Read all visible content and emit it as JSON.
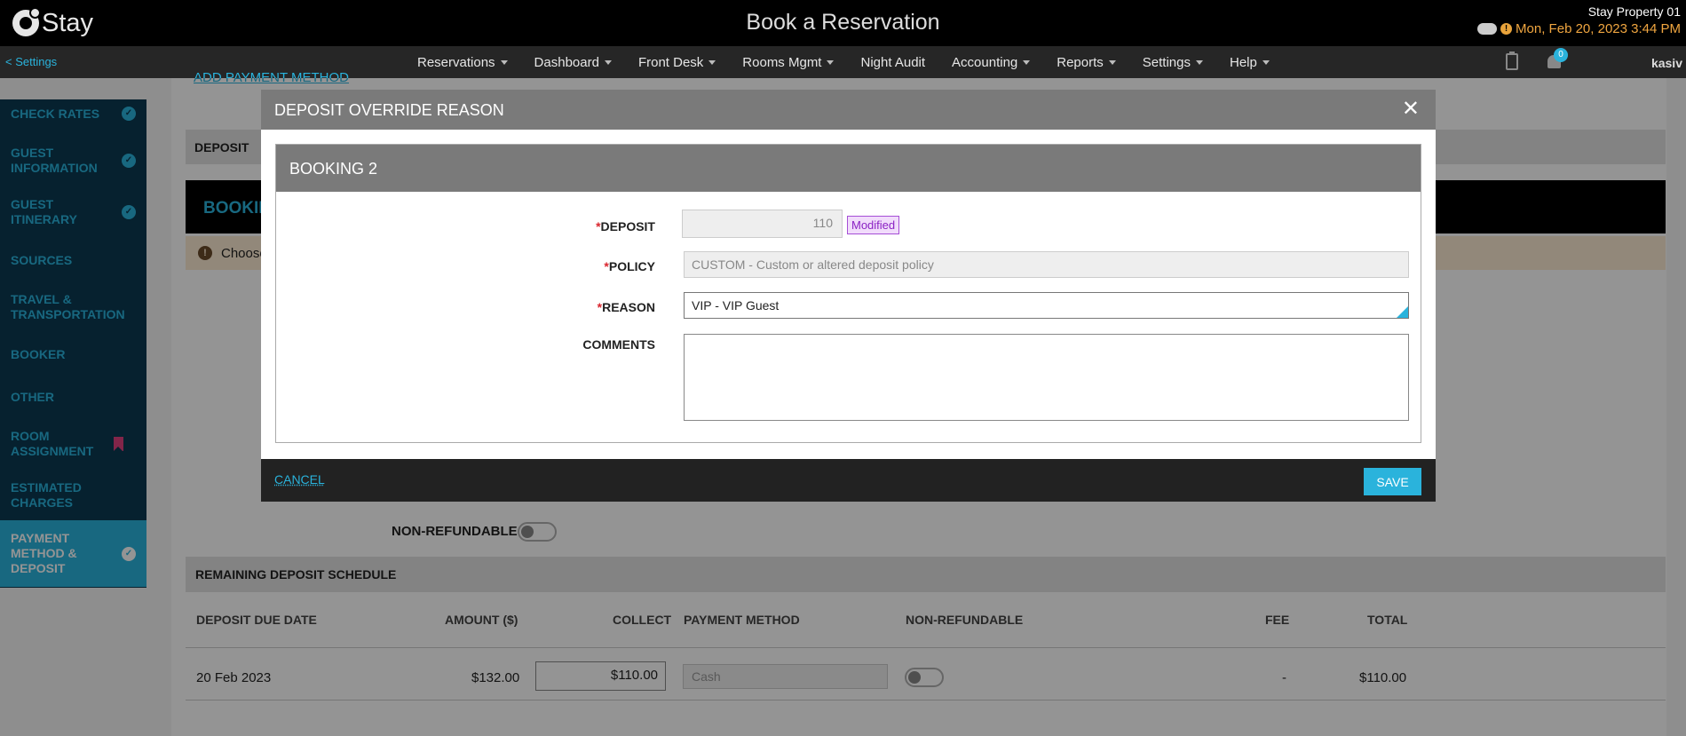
{
  "app": {
    "logo_text": "Stay",
    "title": "Book a Reservation",
    "property": "Stay Property 01",
    "datetime": "Mon, Feb 20, 2023 3:44 PM",
    "user": "kasiv"
  },
  "nav": {
    "back_label": "< Settings",
    "menus": [
      "Reservations",
      "Dashboard",
      "Front Desk",
      "Rooms Mgmt",
      "Night Audit",
      "Accounting",
      "Reports",
      "Settings",
      "Help"
    ],
    "notification_count": "0"
  },
  "sidebar": {
    "items": [
      {
        "label": "CHECK RATES"
      },
      {
        "label": "GUEST INFORMATION"
      },
      {
        "label": "GUEST ITINERARY"
      },
      {
        "label": "SOURCES"
      },
      {
        "label": "TRAVEL & TRANSPORTATION"
      },
      {
        "label": "BOOKER"
      },
      {
        "label": "OTHER"
      },
      {
        "label": "ROOM ASSIGNMENT"
      },
      {
        "label": "ESTIMATED CHARGES"
      },
      {
        "label": "PAYMENT METHOD & DEPOSIT"
      }
    ]
  },
  "background": {
    "add_payment": "ADD PAYMENT METHOD",
    "deposit_header": "DEPOSIT",
    "booking_header": "BOOKIN",
    "notice": "Choose",
    "non_refundable_label": "NON-REFUNDABLE",
    "schedule_header": "REMAINING DEPOSIT SCHEDULE",
    "columns": [
      "DEPOSIT DUE DATE",
      "AMOUNT ($)",
      "COLLECT",
      "PAYMENT METHOD",
      "NON-REFUNDABLE",
      "FEE",
      "TOTAL"
    ],
    "row": {
      "due_date": "20 Feb 2023",
      "amount": "$132.00",
      "collect": "$110.00",
      "payment_method": "Cash",
      "fee": "-",
      "total": "$110.00"
    }
  },
  "modal": {
    "title": "DEPOSIT OVERRIDE REASON",
    "booking_title": "BOOKING 2",
    "deposit_label": "DEPOSIT",
    "deposit_value": "110",
    "modified_badge": "Modified",
    "policy_label": "POLICY",
    "policy_value": "CUSTOM - Custom or altered deposit policy",
    "reason_label": "REASON",
    "reason_value": "VIP - VIP Guest",
    "comments_label": "COMMENTS",
    "comments_value": "",
    "cancel_label": "CANCEL",
    "save_label": "SAVE"
  }
}
